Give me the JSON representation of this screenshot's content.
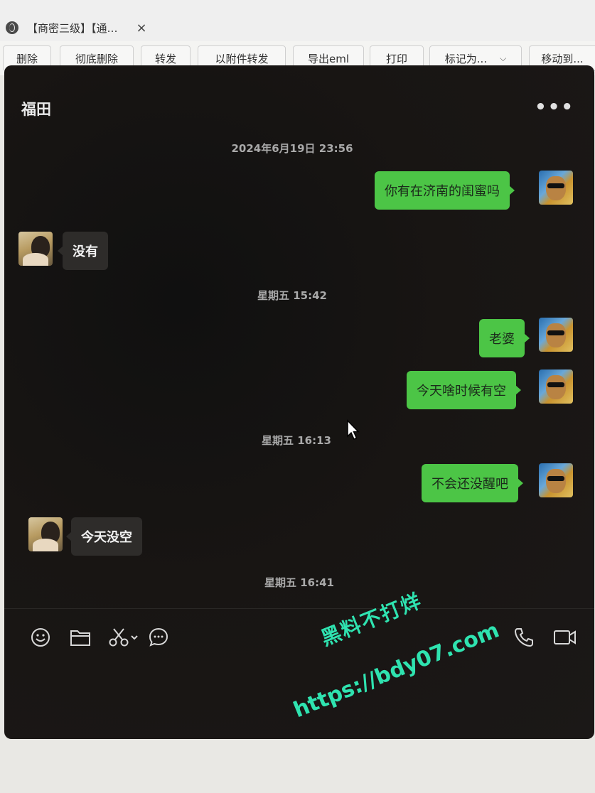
{
  "browser": {
    "tab_title": "【商密三级】【通…",
    "tab_close": "×"
  },
  "mail_toolbar": {
    "buttons": [
      "删除",
      "彻底删除",
      "转发",
      "以附件转发",
      "导出eml",
      "打印",
      "标记为...",
      "移动到..."
    ]
  },
  "chat": {
    "contact_name": "福田",
    "more_label": "•••",
    "messages": [
      {
        "type": "time",
        "text": "2024年6月19日 23:56"
      },
      {
        "type": "out",
        "text": "你有在济南的闺蜜吗"
      },
      {
        "type": "in",
        "text": "没有"
      },
      {
        "type": "time",
        "text": "星期五 15:42"
      },
      {
        "type": "out",
        "text": "老婆"
      },
      {
        "type": "out",
        "text": "今天啥时候有空"
      },
      {
        "type": "time",
        "text": "星期五 16:13"
      },
      {
        "type": "out",
        "text": "不会还没醒吧"
      },
      {
        "type": "in",
        "text": "今天没空"
      },
      {
        "type": "time",
        "text": "星期五 16:41"
      }
    ],
    "input_icons": [
      "emoji-icon",
      "folder-icon",
      "scissors-icon",
      "chat-bubble-icon",
      "phone-icon",
      "video-icon"
    ]
  },
  "watermark": {
    "line1": "黑料不打烊",
    "line2": "https://bdy07.com"
  },
  "colors": {
    "outgoing_bubble": "#4cc546",
    "incoming_bubble": "#2e2c2a",
    "watermark": "#2fe3b0"
  }
}
